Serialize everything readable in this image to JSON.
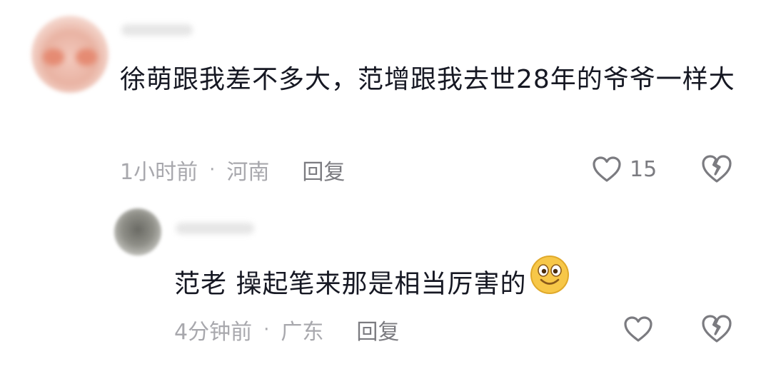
{
  "comments": [
    {
      "text": "徐萌跟我差不多大，范增跟我去世28年的爷爷一样大",
      "time": "1小时前",
      "separator": "·",
      "location": "河南",
      "reply_label": "回复",
      "likes": "15",
      "icons": {
        "like": "heart-outline-icon",
        "dislike": "broken-heart-icon"
      }
    },
    {
      "text": "范老 操起笔来那是相当厉害的",
      "emoji": "smiling-face-emoji-icon",
      "time": "4分钟前",
      "separator": "·",
      "location": "广东",
      "reply_label": "回复",
      "icons": {
        "like": "heart-outline-icon",
        "dislike": "broken-heart-icon"
      }
    }
  ],
  "colors": {
    "text": "#161823",
    "meta": "#a8a8ad",
    "icon": "#7b7b80",
    "emoji": "#f7c748"
  }
}
